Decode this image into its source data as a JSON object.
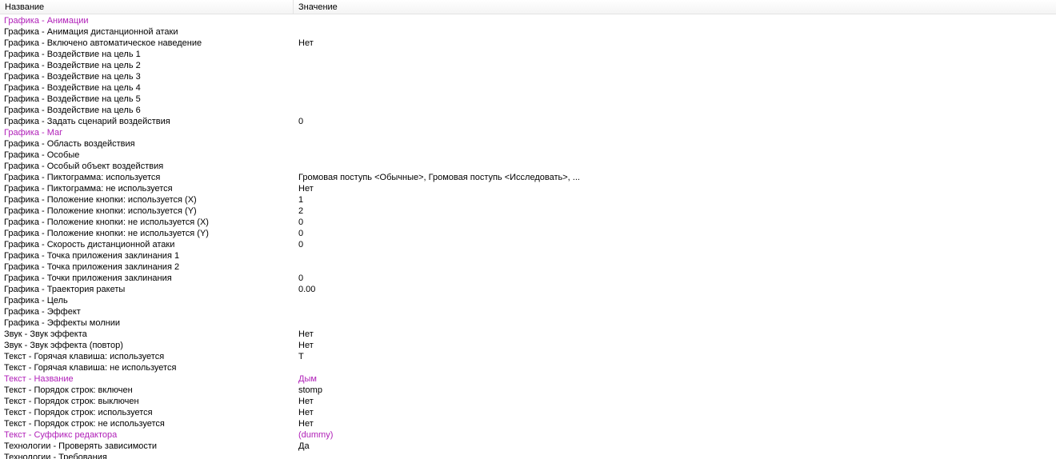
{
  "columns": {
    "name": "Название",
    "value": "Значение"
  },
  "accent_color": "#b01fb8",
  "rows": [
    {
      "name": "Графика - Анимации",
      "value": "",
      "modified": true
    },
    {
      "name": "Графика - Анимация дистанционной атаки",
      "value": ""
    },
    {
      "name": "Графика - Включено автоматическое наведение",
      "value": "Нет"
    },
    {
      "name": "Графика - Воздействие на цель 1",
      "value": ""
    },
    {
      "name": "Графика - Воздействие на цель 2",
      "value": ""
    },
    {
      "name": "Графика - Воздействие на цель 3",
      "value": ""
    },
    {
      "name": "Графика - Воздействие на цель 4",
      "value": ""
    },
    {
      "name": "Графика - Воздействие на цель 5",
      "value": ""
    },
    {
      "name": "Графика - Воздействие на цель 6",
      "value": ""
    },
    {
      "name": "Графика - Задать сценарий воздействия",
      "value": "0"
    },
    {
      "name": "Графика - Маг",
      "value": "",
      "modified": true
    },
    {
      "name": "Графика - Область воздействия",
      "value": ""
    },
    {
      "name": "Графика - Особые",
      "value": ""
    },
    {
      "name": "Графика - Особый объект воздействия",
      "value": ""
    },
    {
      "name": "Графика - Пиктограмма: используется",
      "value": "Громовая поступь <Обычные>, Громовая поступь <Исследовать>, ..."
    },
    {
      "name": "Графика - Пиктограмма: не используется",
      "value": "Нет"
    },
    {
      "name": "Графика - Положение кнопки: используется (X)",
      "value": "1"
    },
    {
      "name": "Графика - Положение кнопки: используется (Y)",
      "value": "2"
    },
    {
      "name": "Графика - Положение кнопки: не используется (X)",
      "value": "0"
    },
    {
      "name": "Графика - Положение кнопки: не используется (Y)",
      "value": "0"
    },
    {
      "name": "Графика - Скорость дистанционной атаки",
      "value": "0"
    },
    {
      "name": "Графика - Точка приложения заклинания 1",
      "value": ""
    },
    {
      "name": "Графика - Точка приложения заклинания 2",
      "value": ""
    },
    {
      "name": "Графика - Точки приложения заклинания",
      "value": "0"
    },
    {
      "name": "Графика - Траектория ракеты",
      "value": "0.00"
    },
    {
      "name": "Графика - Цель",
      "value": ""
    },
    {
      "name": "Графика - Эффект",
      "value": ""
    },
    {
      "name": "Графика - Эффекты молнии",
      "value": ""
    },
    {
      "name": "Звук - Звук эффекта",
      "value": "Нет"
    },
    {
      "name": "Звук - Звук эффекта (повтор)",
      "value": "Нет"
    },
    {
      "name": "Текст - Горячая клавиша: используется",
      "value": "T"
    },
    {
      "name": "Текст - Горячая клавиша: не используется",
      "value": ""
    },
    {
      "name": "Текст - Название",
      "value": "Дым",
      "modified": true
    },
    {
      "name": "Текст - Порядок строк: включен",
      "value": "stomp"
    },
    {
      "name": "Текст - Порядок строк: выключен",
      "value": "Нет"
    },
    {
      "name": "Текст - Порядок строк: используется",
      "value": "Нет"
    },
    {
      "name": "Текст - Порядок строк: не используется",
      "value": "Нет"
    },
    {
      "name": "Текст - Суффикс редактора",
      "value": "(dummy)",
      "modified": true
    },
    {
      "name": "Технологии - Проверять зависимости",
      "value": "Да"
    },
    {
      "name": "Технологии - Требования",
      "value": ""
    }
  ]
}
